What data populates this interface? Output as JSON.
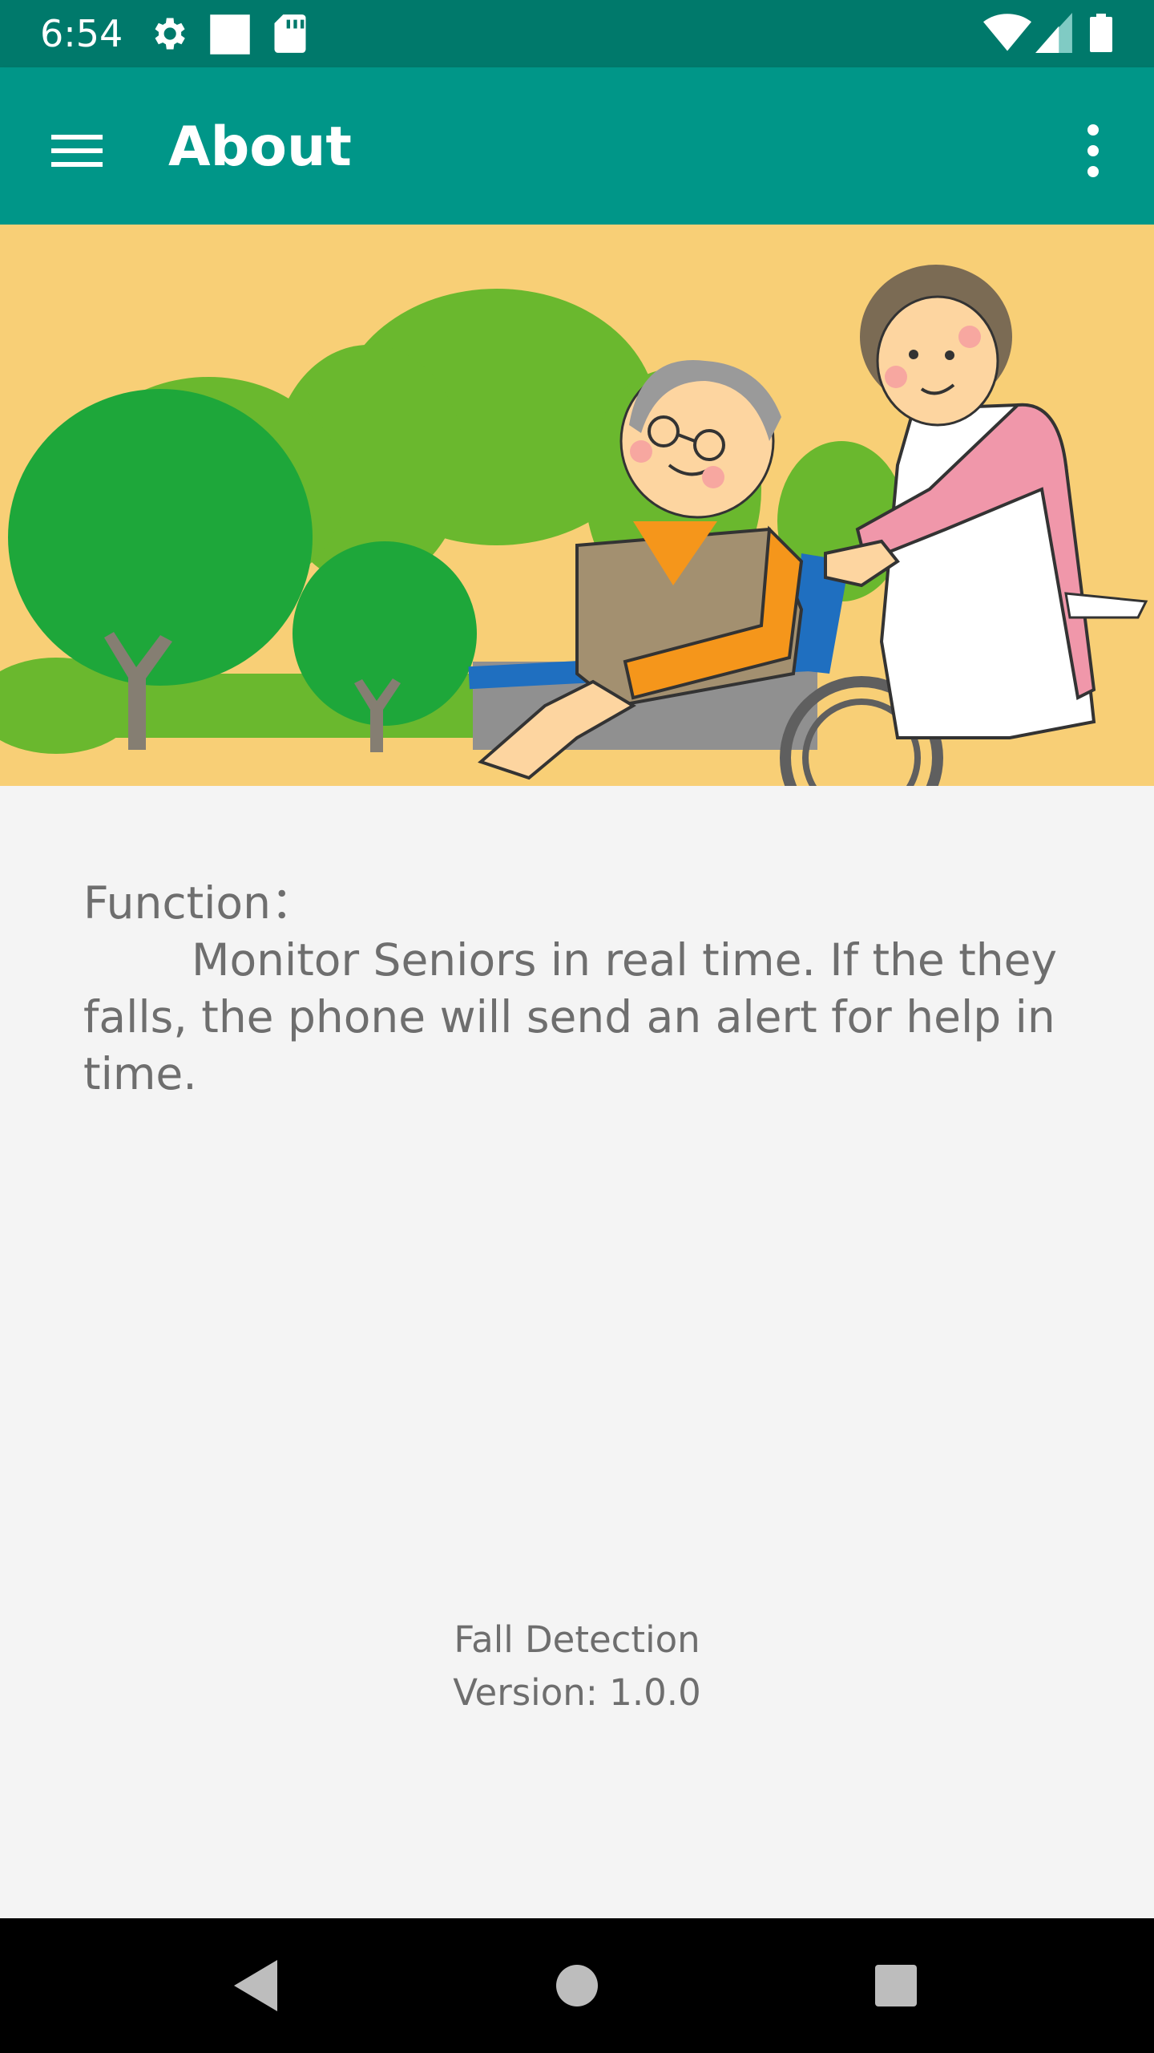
{
  "status_bar": {
    "time": "6:54",
    "icons": [
      "gear-icon",
      "notification-square-icon",
      "sd-card-icon",
      "wifi-icon",
      "cell-signal-icon",
      "battery-icon"
    ],
    "color": "#00796b"
  },
  "app_bar": {
    "title": "About",
    "menu_icon": "hamburger-menu-icon",
    "overflow_icon": "more-vert-icon",
    "color": "#009688"
  },
  "hero": {
    "illustration": "caregiver pushing senior in wheelchair in front of trees",
    "background_color": "#f8cf76"
  },
  "content": {
    "heading": "Function：",
    "body": "Monitor Seniors in real time. If the they falls, the phone will send an alert for help in time.",
    "text_color": "#6e6e6e"
  },
  "footer": {
    "app_name": "Fall Detection",
    "version": "Version: 1.0.0"
  },
  "nav_bar": {
    "back_icon": "back-triangle-icon",
    "home_icon": "home-circle-icon",
    "recents_icon": "recents-square-icon"
  }
}
